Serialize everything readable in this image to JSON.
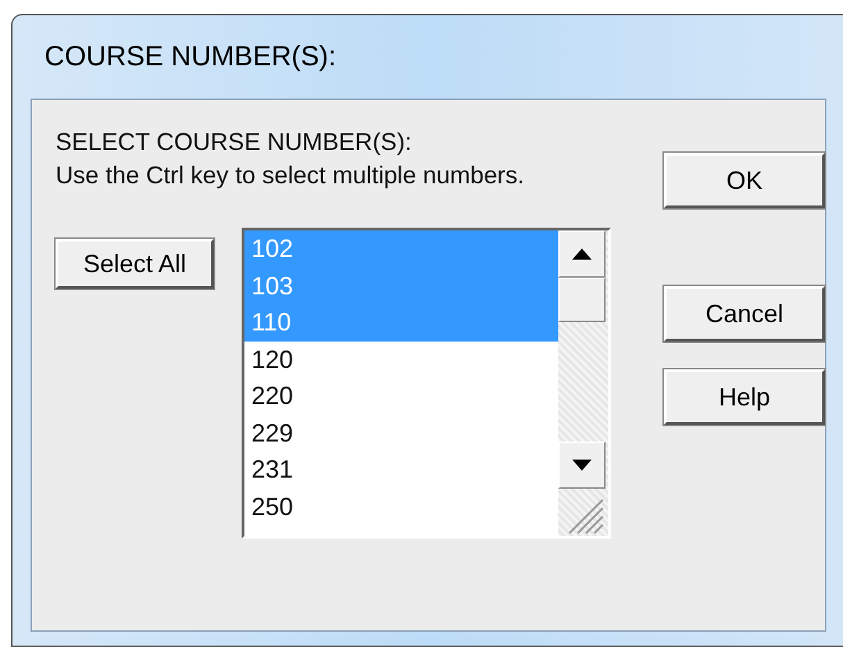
{
  "window": {
    "title": "COURSE NUMBER(S):"
  },
  "instructions": {
    "heading": "SELECT COURSE NUMBER(S):",
    "text": "Use the Ctrl key to select multiple numbers."
  },
  "select_all_button": "Select All",
  "course_list": [
    {
      "label": "102",
      "selected": true
    },
    {
      "label": "103",
      "selected": true
    },
    {
      "label": "110",
      "selected": true
    },
    {
      "label": "120",
      "selected": false
    },
    {
      "label": "220",
      "selected": false
    },
    {
      "label": "229",
      "selected": false
    },
    {
      "label": "231",
      "selected": false
    },
    {
      "label": "250",
      "selected": false
    }
  ],
  "buttons": [
    "OK",
    "Cancel",
    "Help"
  ]
}
